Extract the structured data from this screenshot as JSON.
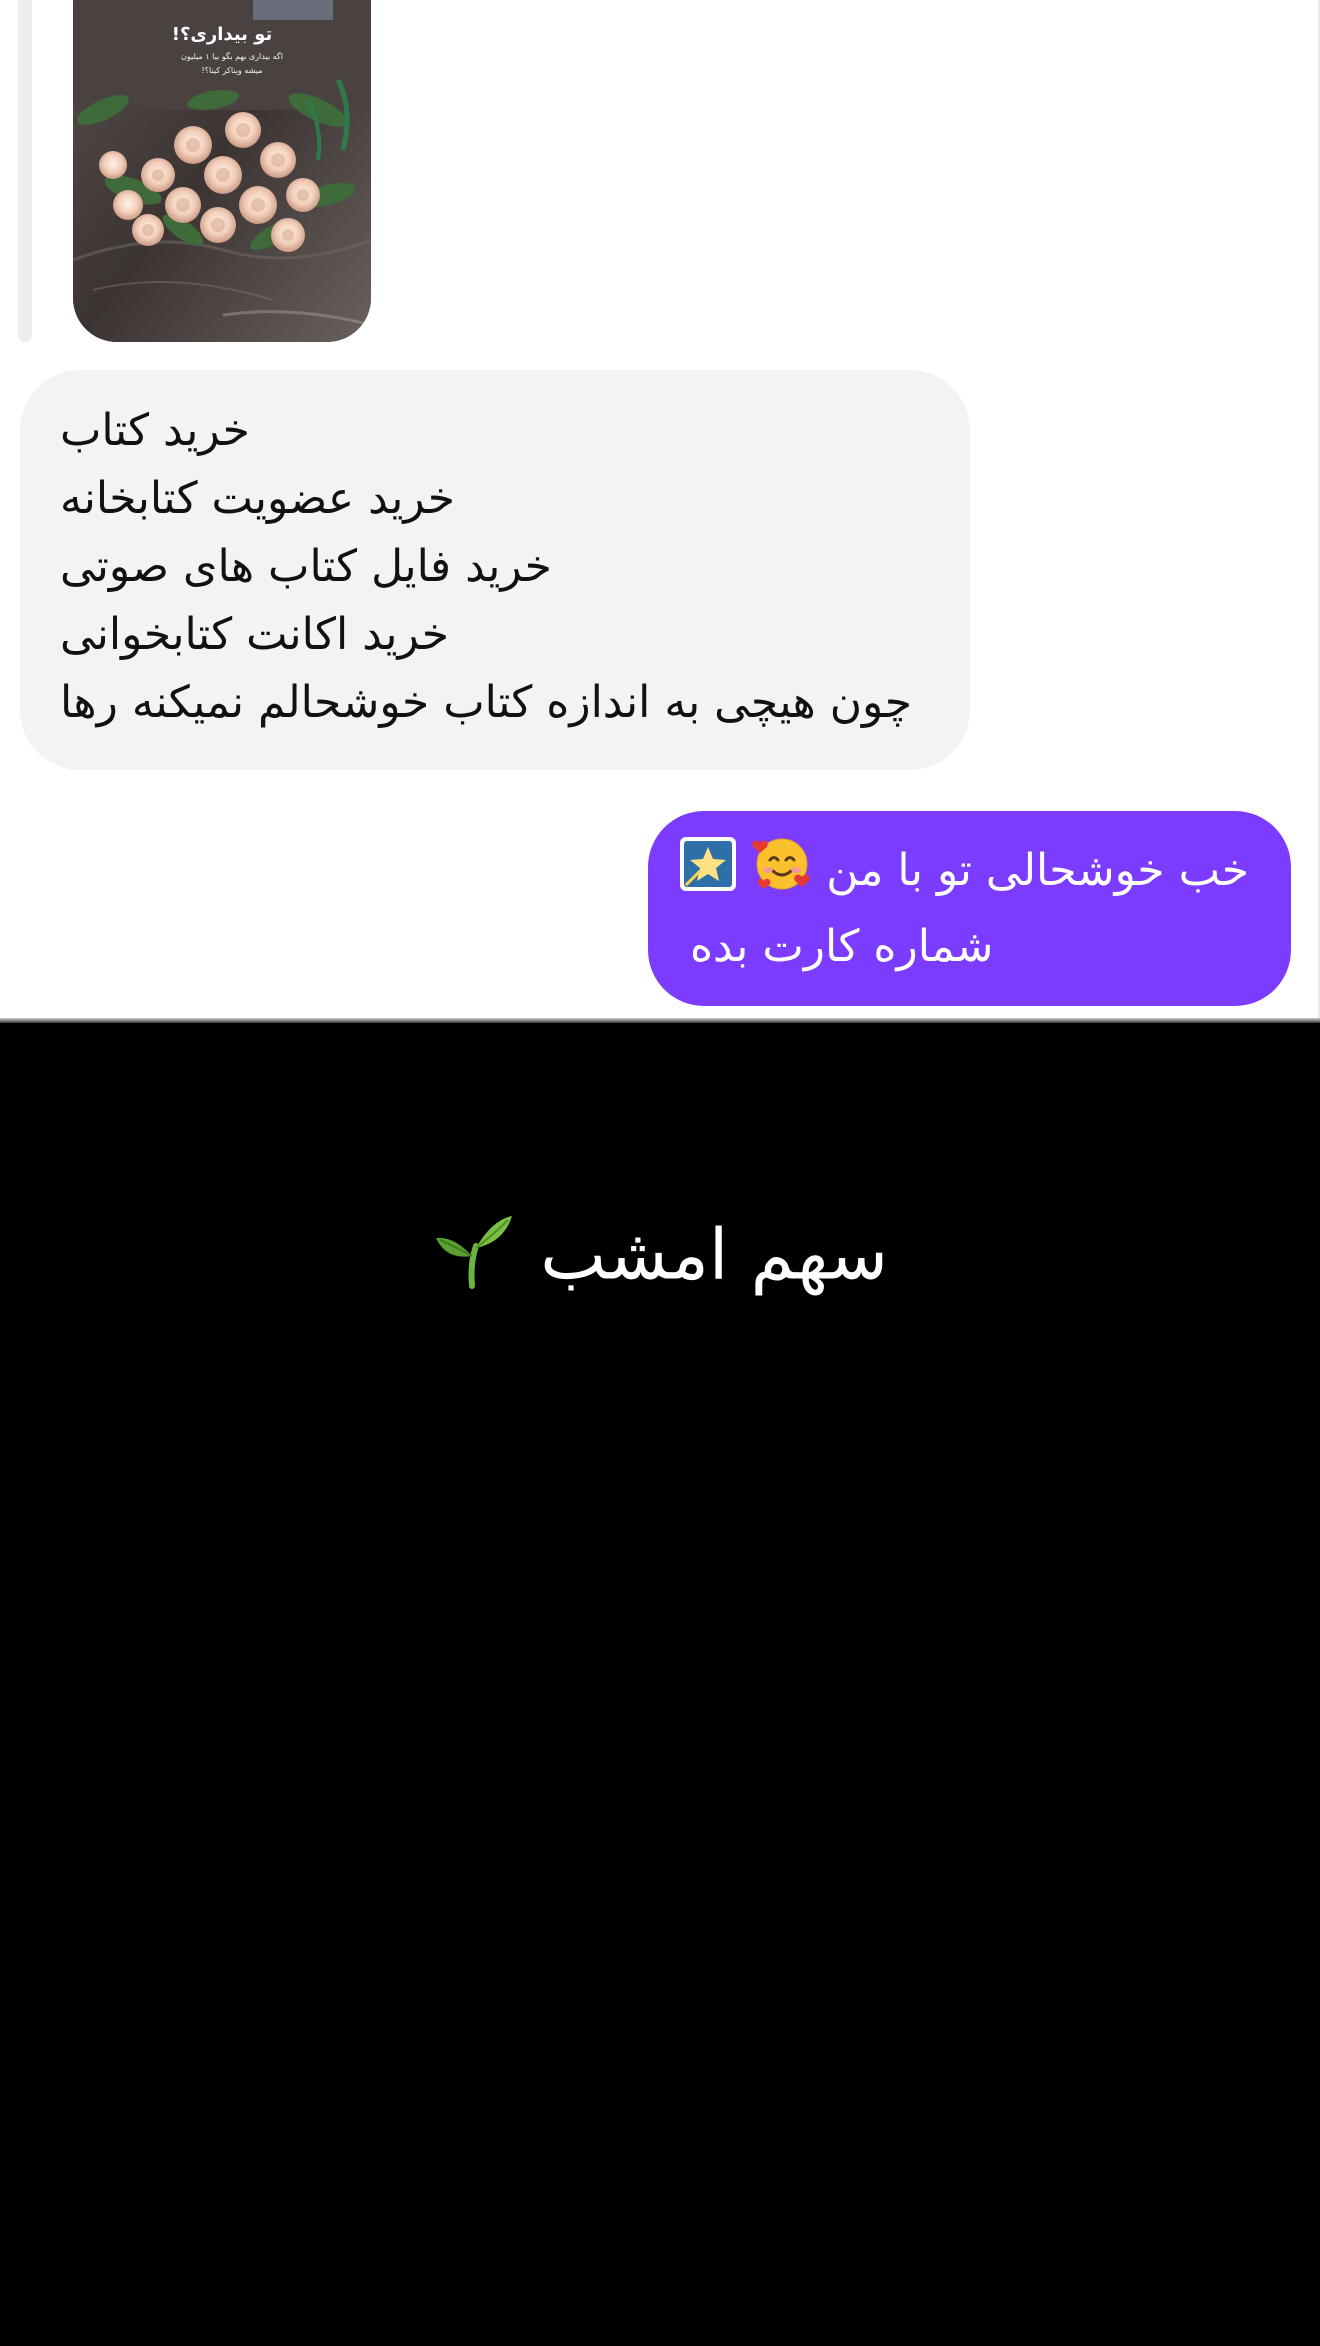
{
  "story_reply": {
    "title": "تو بیداری؟!",
    "caption": "اگه بیداری بهم بگو بیا ۱ میلیون میشه ویناکر کینا؟!"
  },
  "received_message": {
    "lines": [
      "خرید کتاب",
      "خرید عضویت کتابخانه",
      "خرید فایل کتاب های صوتی",
      "خرید اکانت کتابخوانی",
      "چون هیچی به اندازه کتاب خوشحالم نمیکنه رها"
    ]
  },
  "sent_message": {
    "line1": "خب خوشحالی تو با من",
    "line2": "شماره کارت بده",
    "emojis": [
      "smiling-face-with-hearts-icon",
      "glowing-star-icon"
    ]
  },
  "footer": {
    "title": "سهم امشب"
  },
  "colors": {
    "sent_bubble": "#7c3cff",
    "received_bubble": "#f2f3f5",
    "background_bottom": "#000000"
  }
}
